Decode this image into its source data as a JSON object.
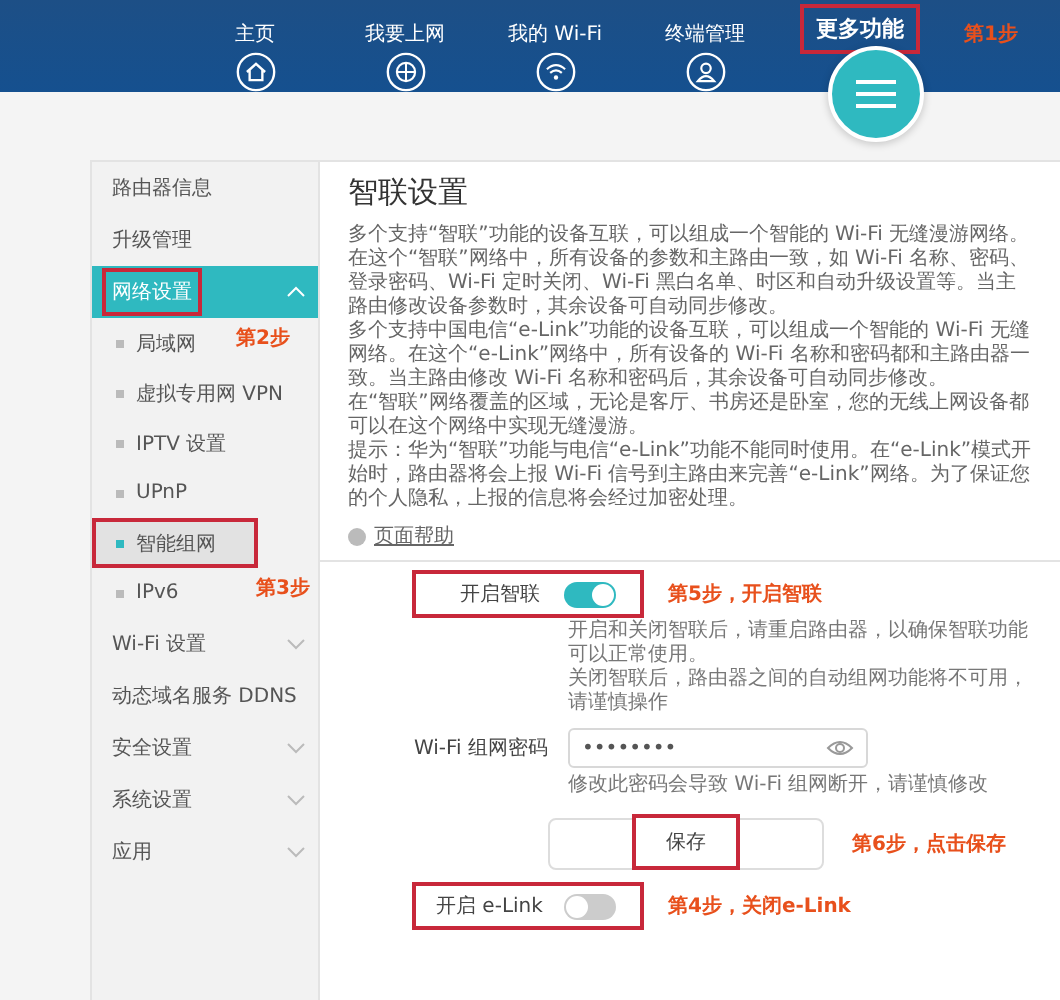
{
  "header": {
    "nav": [
      {
        "label": "主页",
        "kind": "home",
        "selected": false
      },
      {
        "label": "我要上网",
        "kind": "globe",
        "selected": false
      },
      {
        "label": "我的 Wi-Fi",
        "kind": "wifi",
        "selected": false
      },
      {
        "label": "终端管理",
        "kind": "user",
        "selected": false
      }
    ],
    "more": {
      "label": "更多功能",
      "highlighted": true,
      "step_note": "第1步"
    }
  },
  "sidebar": {
    "items": [
      {
        "label": "路由器信息",
        "selected": false,
        "highlighted": false
      },
      {
        "label": "升级管理",
        "selected": false,
        "highlighted": false
      },
      {
        "label": "网络设置",
        "selected": true,
        "expanded": true,
        "highlighted": true,
        "step_note": "第2步",
        "children": [
          {
            "label": "局域网",
            "selected": false,
            "highlighted": false
          },
          {
            "label": "虚拟专用网 VPN",
            "selected": false,
            "highlighted": false
          },
          {
            "label": "IPTV 设置",
            "selected": false,
            "highlighted": false
          },
          {
            "label": "UPnP",
            "selected": false,
            "highlighted": false
          },
          {
            "label": "智能组网",
            "selected": true,
            "highlighted": true,
            "step_note": "第3步"
          },
          {
            "label": "IPv6",
            "selected": false,
            "highlighted": false
          }
        ]
      },
      {
        "label": "Wi-Fi 设置",
        "selected": false,
        "expanded": false,
        "highlighted": false
      },
      {
        "label": "动态域名服务 DDNS",
        "selected": false,
        "highlighted": false
      },
      {
        "label": "安全设置",
        "selected": false,
        "expanded": false,
        "highlighted": false
      },
      {
        "label": "系统设置",
        "selected": false,
        "expanded": false,
        "highlighted": false
      },
      {
        "label": "应用",
        "selected": false,
        "expanded": false,
        "highlighted": false
      }
    ]
  },
  "content": {
    "title": "智联设置",
    "paragraphs": [
      "多个支持“智联”功能的设备互联，可以组成一个智能的 Wi-Fi 无缝漫游网络。在这个“智联”网络中，所有设备的参数和主路由一致，如 Wi-Fi 名称、密码、登录密码、Wi-Fi 定时关闭、Wi-Fi 黑白名单、时区和自动升级设置等。当主路由修改设备参数时，其余设备可自动同步修改。",
      "多个支持中国电信“e-Link”功能的设备互联，可以组成一个智能的 Wi-Fi 无缝网络。在这个“e-Link”网络中，所有设备的 Wi-Fi 名称和密码都和主路由器一致。当主路由修改 Wi-Fi 名称和密码后，其余设备可自动同步修改。",
      "在“智联”网络覆盖的区域，无论是客厅、书房还是卧室，您的无线上网设备都可以在这个网络中实现无缝漫游。",
      "提示：华为“智联”功能与电信“e-Link”功能不能同时使用。在“e-Link”模式开始时，路由器将会上报 Wi-Fi 信号到主路由来完善“e-Link”网络。为了保证您的个人隐私，上报的信息将会经过加密处理。"
    ],
    "help_link": "页面帮助",
    "smart_link": {
      "label": "开启智联",
      "on": true,
      "highlighted": true,
      "step_note": "第5步，开启智联",
      "hints": [
        "开启和关闭智联后，请重启路由器，以确保智联功能可以正常使用。",
        "关闭智联后，路由器之间的自动组网功能将不可用，请谨慎操作"
      ]
    },
    "password": {
      "label": "Wi-Fi 组网密码",
      "value": "••••••••",
      "hint": "修改此密码会导致 Wi-Fi 组网断开，请谨慎修改"
    },
    "save": {
      "label": "保存",
      "highlighted": true,
      "step_note": "第6步，点击保存"
    },
    "elink": {
      "label": "开启 e-Link",
      "on": false,
      "highlighted": true,
      "step_note": "第4步，关闭e-Link"
    }
  }
}
